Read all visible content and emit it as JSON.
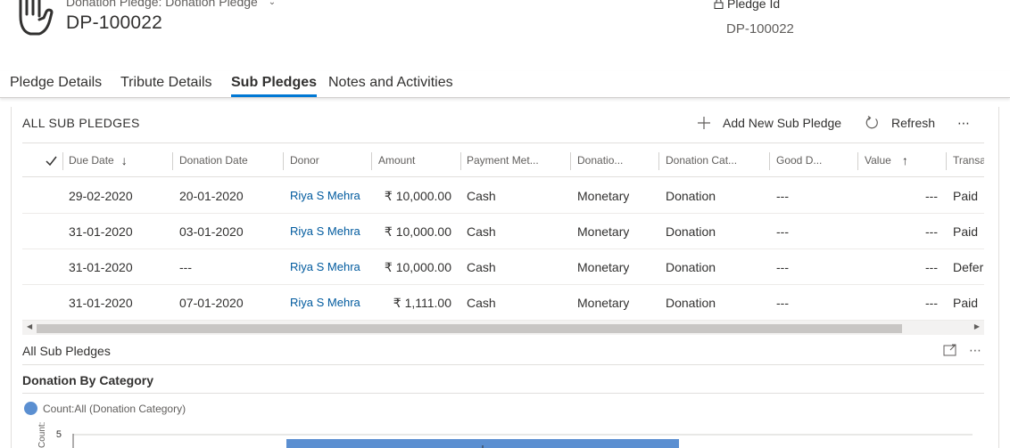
{
  "header": {
    "entity_type": "Donation Pledge: Donation Pledge",
    "record_title": "DP-100022",
    "pledge_id_label": "Pledge Id",
    "pledge_id_value": "DP-100022",
    "icons": {
      "entity": "hand-icon",
      "lock": "lock-icon",
      "chevron": "chevron-down-icon"
    }
  },
  "tabs": [
    {
      "label": "Pledge Details",
      "active": false
    },
    {
      "label": "Tribute Details",
      "active": false
    },
    {
      "label": "Sub Pledges",
      "active": true
    },
    {
      "label": "Notes and Activities",
      "active": false
    }
  ],
  "subgrid": {
    "title": "ALL SUB PLEDGES",
    "commands": {
      "add_label": "Add New Sub Pledge",
      "refresh_label": "Refresh",
      "more": "⋯"
    },
    "columns": [
      {
        "label": "Due Date",
        "sort": "descending"
      },
      {
        "label": "Donation Date"
      },
      {
        "label": "Donor"
      },
      {
        "label": "Amount"
      },
      {
        "label": "Payment Met..."
      },
      {
        "label": "Donatio..."
      },
      {
        "label": "Donation Cat..."
      },
      {
        "label": "Good D..."
      },
      {
        "label": "Value",
        "sort": "ascending"
      },
      {
        "label": "Transa"
      }
    ],
    "rows": [
      [
        "29-02-2020",
        "20-01-2020",
        "Riya S Mehra",
        "₹ 10,000.00",
        "Cash",
        "Monetary",
        "Donation",
        "---",
        "---",
        "Paid"
      ],
      [
        "31-01-2020",
        "03-01-2020",
        "Riya S Mehra",
        "₹ 10,000.00",
        "Cash",
        "Monetary",
        "Donation",
        "---",
        "---",
        "Paid"
      ],
      [
        "31-01-2020",
        "---",
        "Riya S Mehra",
        "₹ 10,000.00",
        "Cash",
        "Monetary",
        "Donation",
        "---",
        "---",
        "Defer"
      ],
      [
        "31-01-2020",
        "07-01-2020",
        "Riya S Mehra",
        "₹ 1,111.00",
        "Cash",
        "Monetary",
        "Donation",
        "---",
        "---",
        "Paid"
      ]
    ]
  },
  "chart_section": {
    "view_title": "All Sub Pledges",
    "chart_title": "Donation By Category",
    "more": "⋯"
  },
  "chart_data": {
    "type": "bar",
    "title": "Donation By Category",
    "series": [
      {
        "name": "Count:All (Donation Category)",
        "color": "#5b8fd1"
      }
    ],
    "ylabel": "Count:A...",
    "y_tick_visible": "5"
  },
  "colors": {
    "accent": "#0078d4",
    "link": "#005a9e",
    "bar": "#5b8fd1"
  }
}
